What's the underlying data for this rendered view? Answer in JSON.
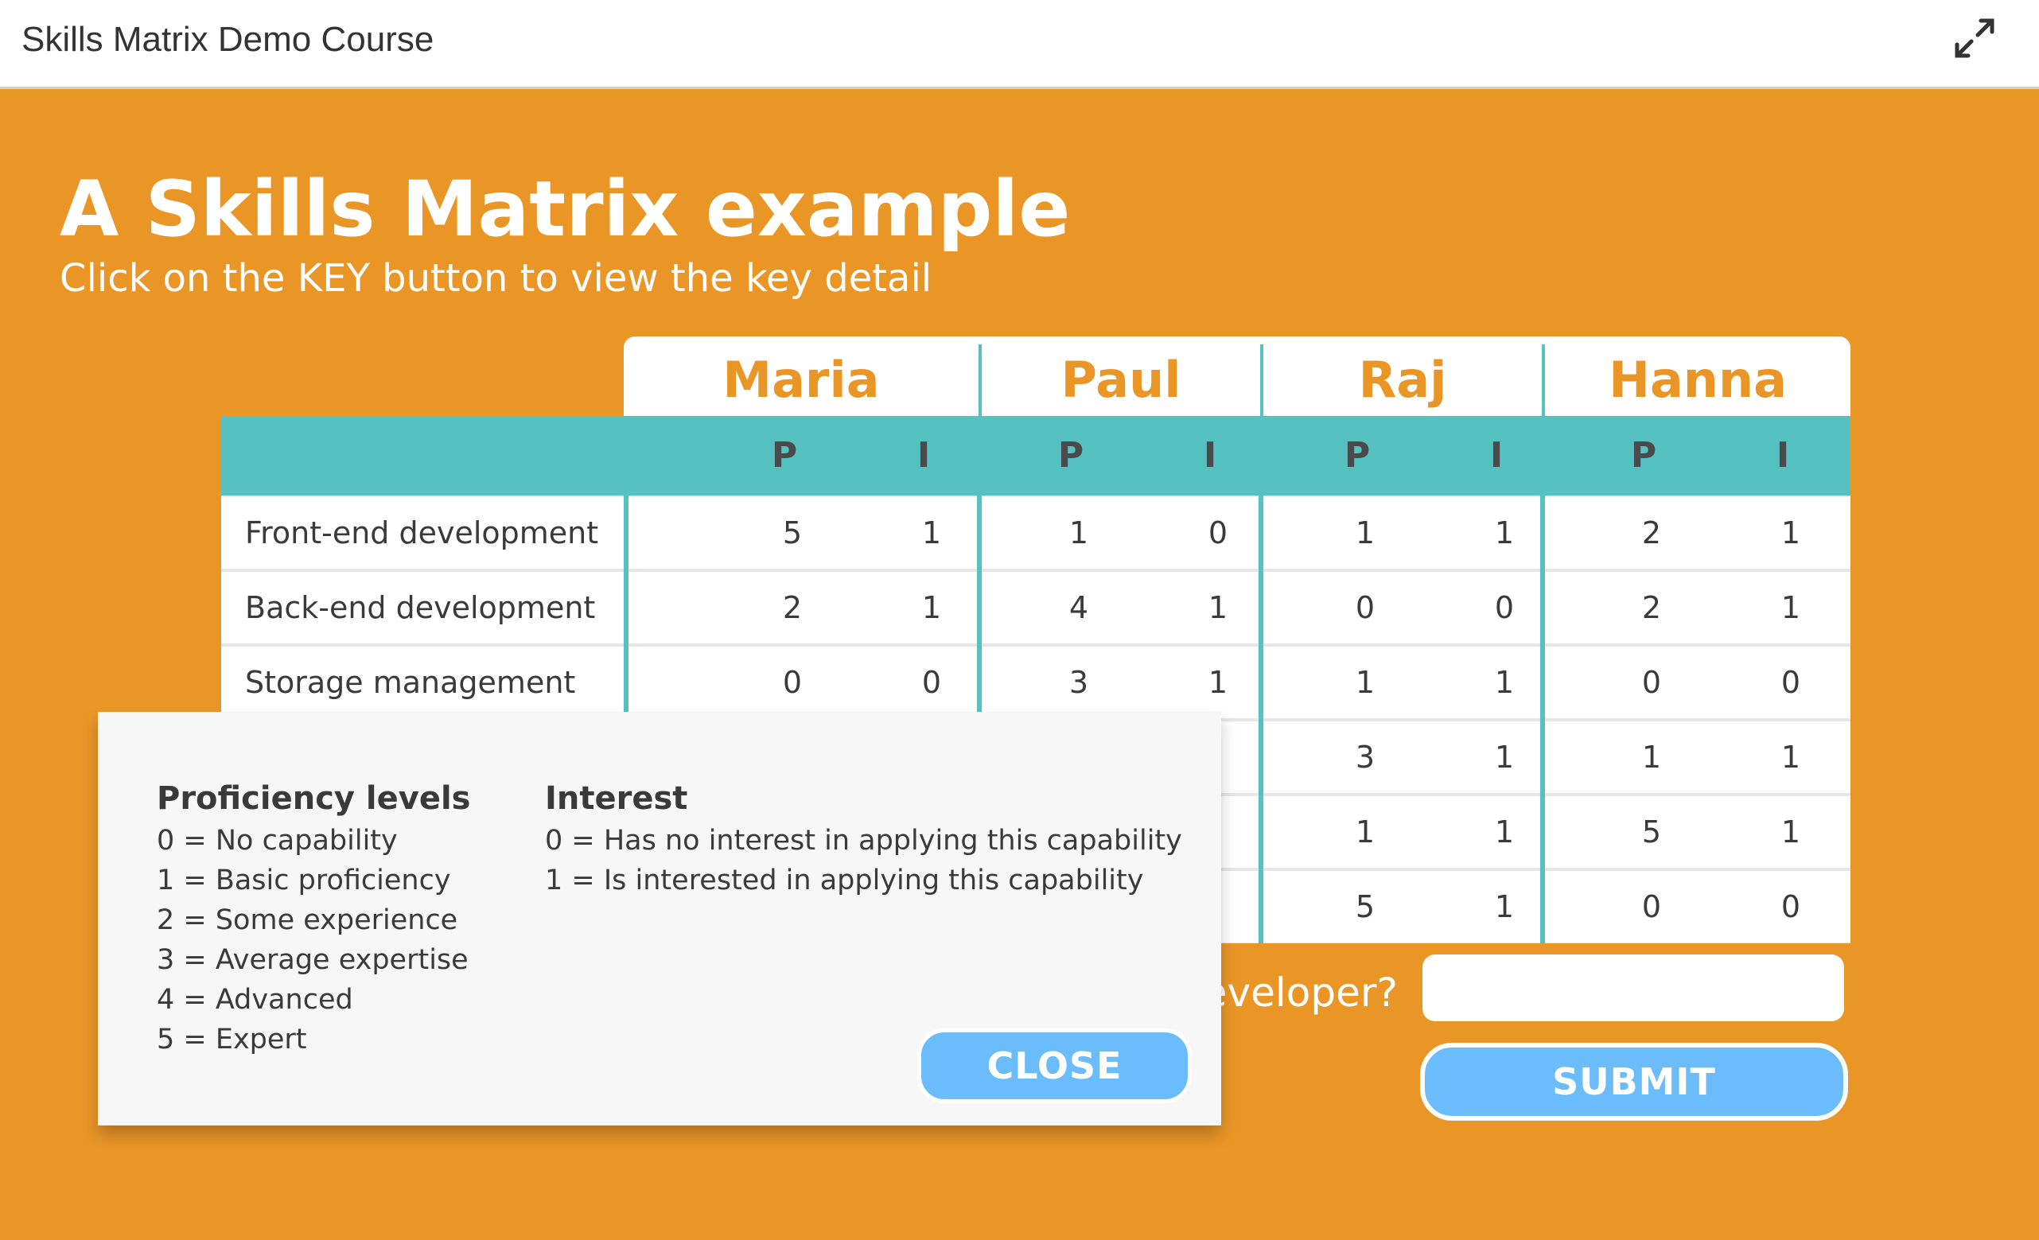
{
  "topbar": {
    "course_title": "Skills Matrix Demo Course",
    "expand_icon": "expand-arrows-icon"
  },
  "slide": {
    "heading": "A Skills Matrix example",
    "subheading": "Click on the KEY button to view the key detail"
  },
  "matrix": {
    "people": [
      "Maria",
      "Paul",
      "Raj",
      "Hanna"
    ],
    "sub_headers": [
      "P",
      "I",
      "P",
      "I",
      "P",
      "I",
      "P",
      "I"
    ],
    "rows": [
      {
        "label": "Front-end development",
        "values": [
          "5",
          "1",
          "1",
          "0",
          "1",
          "1",
          "2",
          "1"
        ]
      },
      {
        "label": "Back-end development",
        "values": [
          "2",
          "1",
          "4",
          "1",
          "0",
          "0",
          "2",
          "1"
        ]
      },
      {
        "label": "Storage management",
        "values": [
          "0",
          "0",
          "3",
          "1",
          "1",
          "1",
          "0",
          "0"
        ]
      },
      {
        "label": "",
        "values": [
          "",
          "",
          "",
          "",
          "3",
          "1",
          "1",
          "1"
        ]
      },
      {
        "label": "",
        "values": [
          "",
          "",
          "",
          "",
          "1",
          "1",
          "5",
          "1"
        ]
      },
      {
        "label": "",
        "values": [
          "",
          "",
          "",
          "",
          "5",
          "1",
          "0",
          "0"
        ]
      }
    ]
  },
  "question": {
    "text": "developer?",
    "input_value": ""
  },
  "submit_label": "SUBMIT",
  "key_popup": {
    "proficiency_title": "Proficiency levels",
    "proficiency_items": [
      "0 = No capability",
      "1 = Basic proficiency",
      "2 = Some experience",
      "3 = Average expertise",
      "4 = Advanced",
      "5 = Expert"
    ],
    "interest_title": "Interest",
    "interest_items": [
      "0 = Has no interest in applying this capability",
      "1 = Is interested in applying this capability"
    ],
    "close_label": "CLOSE"
  },
  "colors": {
    "background": "#ea9627",
    "teal": "#55c1c1",
    "button_blue": "#6bbcfa",
    "name_orange": "#ea9627"
  }
}
